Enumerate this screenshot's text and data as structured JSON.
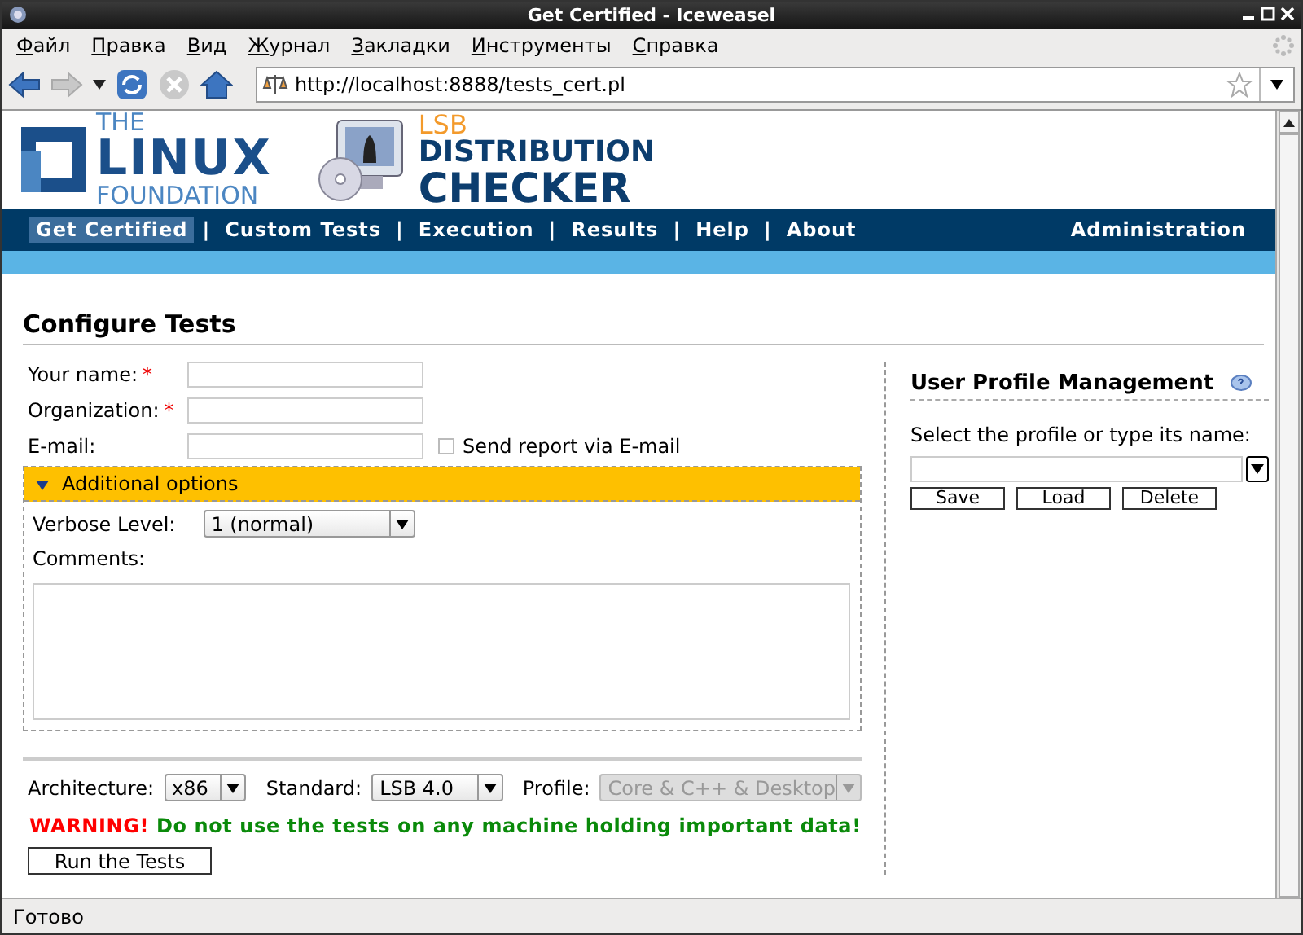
{
  "window": {
    "title": "Get Certified - Iceweasel"
  },
  "menu": [
    "Файл",
    "Правка",
    "Вид",
    "Журнал",
    "Закладки",
    "Инструменты",
    "Справка"
  ],
  "address_bar": {
    "value": "http://localhost:8888/tests_cert.pl"
  },
  "header": {
    "foundation_logo": [
      "THE",
      "LINUX",
      "FOUNDATION"
    ],
    "checker_logo": [
      "LSB",
      "DISTRIBUTION",
      "CHECKER"
    ]
  },
  "nav": {
    "items": [
      {
        "label": "Get Certified",
        "selected": true
      },
      {
        "label": "Custom Tests",
        "selected": false
      },
      {
        "label": "Execution",
        "selected": false
      },
      {
        "label": "Results",
        "selected": false
      },
      {
        "label": "Help",
        "selected": false
      },
      {
        "label": "About",
        "selected": false
      }
    ],
    "separator": "|",
    "right": "Administration"
  },
  "heading": "Configure Tests",
  "fields": [
    {
      "label": "Your name:",
      "required_mark": "*"
    },
    {
      "label": "Organization:",
      "required_mark": "*"
    },
    {
      "label": "E-mail:"
    }
  ],
  "email_option": {
    "label": "Send report via E-mail",
    "checked": false
  },
  "additional_options": {
    "title": "Additional options",
    "expanded": true,
    "verbose_label": "Verbose Level:",
    "verbose_value": "1 (normal)",
    "comments_label": "Comments:"
  },
  "selects": [
    {
      "label": "Architecture:",
      "value": "x86",
      "disabled": false
    },
    {
      "label": "Standard:",
      "value": "LSB 4.0",
      "disabled": false
    },
    {
      "label": "Profile:",
      "value": "Core & C++ & Desktop",
      "disabled": true
    }
  ],
  "warning": {
    "prefix": "WARNING!",
    "message": "Do not use the tests on any machine holding important data!"
  },
  "run_button": "Run the Tests",
  "profile_panel": {
    "title": "User Profile Management",
    "prompt": "Select the profile or type its name:",
    "buttons": [
      "Save",
      "Load",
      "Delete"
    ]
  },
  "status_bar": "Готово"
}
